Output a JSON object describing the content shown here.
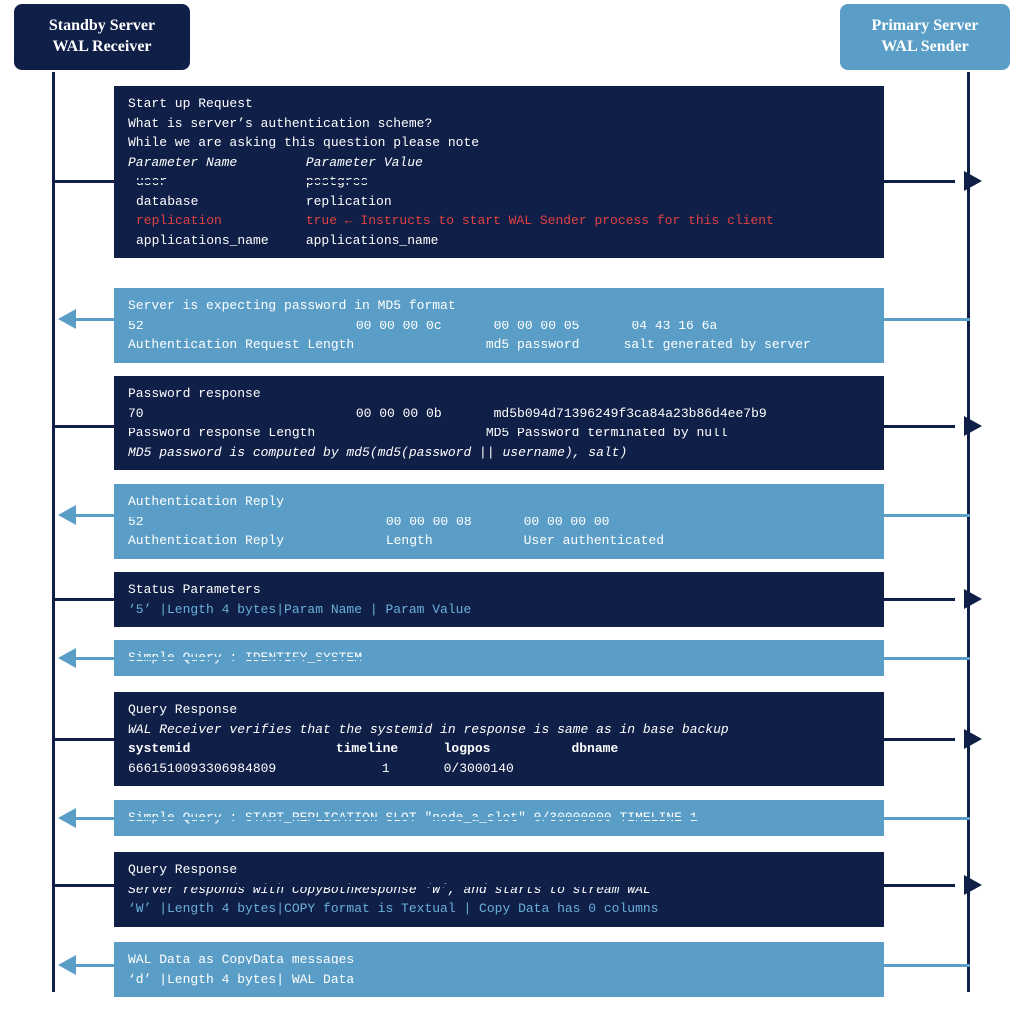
{
  "colors": {
    "dark": "#0f1f48",
    "light": "#5a9ec7",
    "red": "#e04040",
    "blue_accent": "#6ab0d8"
  },
  "left_header": {
    "line1": "Standby Server",
    "line2": "WAL Receiver"
  },
  "right_header": {
    "line1": "Primary Server",
    "line2": "WAL Sender"
  },
  "msg1": {
    "line1": "Start up Request",
    "line2": "What is server’s authentication scheme?",
    "line3": "While we are asking this question please note",
    "h1": "Parameter Name",
    "h2": "Parameter Value",
    "p1n": "user",
    "p1v": "postgres",
    "p2n": "database",
    "p2v": "replication",
    "p3n": "replication",
    "p3v": "true ← Instructs to start WAL Sender process for this client",
    "p4n": "applications_name",
    "p4v": "applications_name"
  },
  "msg2": {
    "line1": "Server is expecting password in MD5 format",
    "c1": "52",
    "c2": "00 00 00 0c",
    "c3": "00 00 00 05",
    "c4": "04 43 16 6a",
    "l1": "Authentication Request Length",
    "l3": "md5 password",
    "l4": "salt generated by server"
  },
  "msg3": {
    "line1": "Password response",
    "c1": "70",
    "c2": "00 00 00 0b",
    "c3": "md5b094d71396249f3ca84a23b86d4ee7b9",
    "l1": "Password response Length",
    "l3": "MD5 Password terminated by null",
    "note": "MD5 password is computed by md5(md5(password || username), salt)"
  },
  "msg4": {
    "line1": "Authentication Reply",
    "c1": "52",
    "c2": "00 00 00 08",
    "c3": "00 00 00 00",
    "l1": "Authentication Reply",
    "l2": "Length",
    "l3": "User authenticated"
  },
  "msg5": {
    "line1": "Status Parameters",
    "line2": "‘5’ |Length 4 bytes|Param Name | Param Value"
  },
  "msg6": {
    "line1": "Simple Query : IDENTIFY_SYSTEM"
  },
  "msg7": {
    "line1": "Query Response",
    "note": "WAL Receiver verifies that the systemid in response is same as in base backup",
    "h1": "systemid",
    "h2": "timeline",
    "h3": "logpos",
    "h4": "dbname",
    "v1": "6661510093306984809",
    "v2": "1",
    "v3": "0/3000140",
    "v4": ""
  },
  "msg8": {
    "line1": "Simple Query : START_REPLICATION SLOT \"node_a_slot\" 0/30000000 TIMELINE 1"
  },
  "msg9": {
    "line1": "Query Response",
    "note": "Server responds with CopyBothResponse ‘W’, and starts to stream WAL",
    "line3": "‘W’ |Length 4 bytes|COPY format is Textual | Copy Data has 0 columns"
  },
  "msg10": {
    "line1": "WAL Data as CopyData messages",
    "line2": "‘d’ |Length 4 bytes| WAL Data"
  }
}
